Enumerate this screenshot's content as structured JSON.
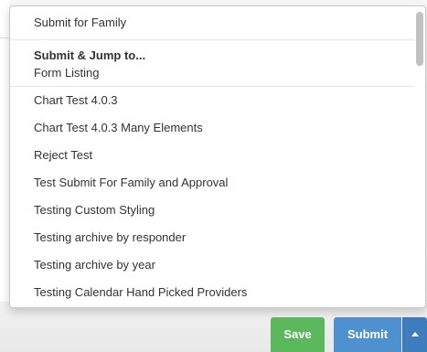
{
  "menu": {
    "submit_for_family": "Submit for Family",
    "group_header": "Submit & Jump to...",
    "form_listing": "Form Listing",
    "forms": [
      "Chart Test 4.0.3",
      "Chart Test 4.0.3 Many Elements",
      "Reject Test",
      "Test Submit For Family and Approval",
      "Testing Custom Styling",
      "Testing archive by responder",
      "Testing archive by year",
      "Testing Calendar Hand Picked Providers"
    ]
  },
  "buttons": {
    "save_label": "Save",
    "submit_label": "Submit",
    "caret_icon": "caret-up-icon"
  },
  "colors": {
    "save": "#5cb85c",
    "submit": "#4f90cf",
    "caret": "#3d7dbd"
  }
}
